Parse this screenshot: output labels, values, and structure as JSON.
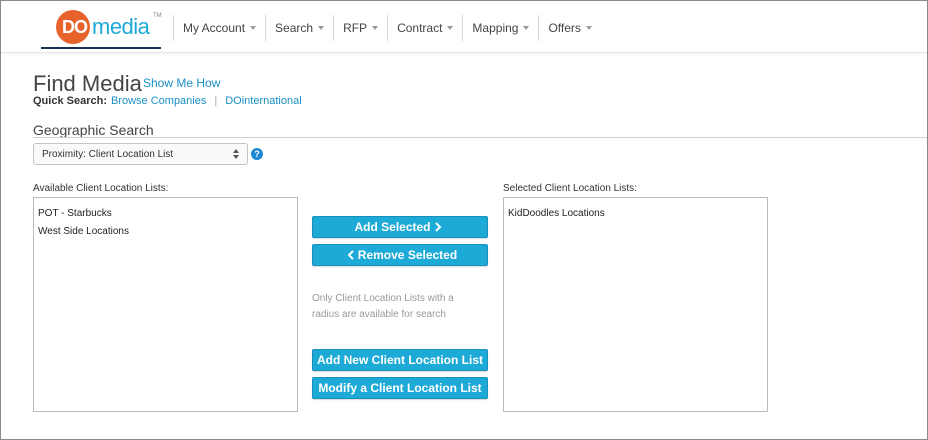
{
  "logo": {
    "do": "DO",
    "media": "media",
    "tm": "TM"
  },
  "nav": [
    {
      "label": "My Account"
    },
    {
      "label": "Search"
    },
    {
      "label": "RFP"
    },
    {
      "label": "Contract"
    },
    {
      "label": "Mapping"
    },
    {
      "label": "Offers"
    }
  ],
  "page": {
    "title": "Find Media",
    "show_me_how": "Show Me How",
    "quick_search_label": "Quick Search:",
    "quick_search_links": [
      "Browse Companies",
      "DOinternational"
    ]
  },
  "geo": {
    "section_title": "Geographic Search",
    "select_value": "Proximity: Client Location List",
    "help": "?"
  },
  "available": {
    "label": "Available Client Location Lists:",
    "items": [
      "POT - Starbucks",
      "West Side Locations"
    ]
  },
  "selected": {
    "label": "Selected Client Location Lists:",
    "items": [
      "KidDoodles Locations"
    ]
  },
  "actions": {
    "add_selected": "Add Selected",
    "remove_selected": "Remove Selected",
    "note": "Only Client Location Lists with a radius are available for search",
    "add_new": "Add New Client Location List",
    "modify": "Modify a Client Location List"
  },
  "colors": {
    "accent": "#1eaad6",
    "brand_orange": "#e8622b",
    "link": "#1a8fc6"
  }
}
